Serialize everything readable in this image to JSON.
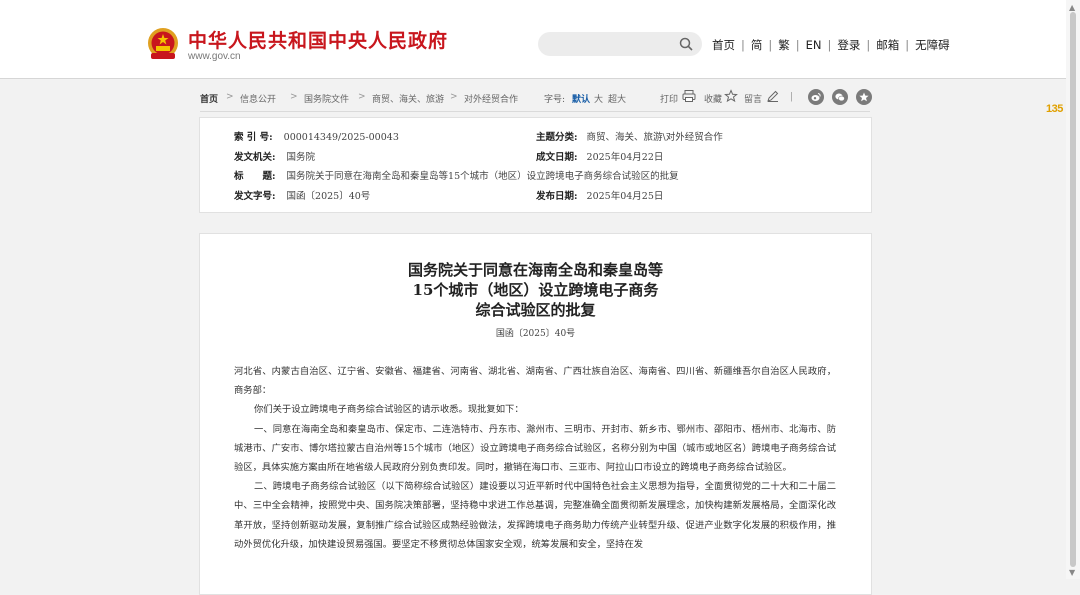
{
  "header": {
    "site_title": "中华人民共和国中央人民政府",
    "site_url": "www.gov.cn",
    "search_placeholder": "",
    "nav": [
      "首页",
      "简",
      "繁",
      "EN",
      "登录",
      "邮箱",
      "无障碍"
    ]
  },
  "breadcrumb": {
    "items": [
      "首页",
      "信息公开",
      "国务院文件",
      "商贸、海关、旅游",
      "对外经贸合作"
    ],
    "font_label": "字号:",
    "font_sizes": [
      "默认",
      "大",
      "超大"
    ],
    "print": "打印",
    "favorite": "收藏",
    "comment": "留言"
  },
  "meta": {
    "index_label": "索 引 号:",
    "index_value": "000014349/2025-00043",
    "category_label": "主题分类:",
    "category_value": "商贸、海关、旅游\\对外经贸合作",
    "issuer_label": "发文机关:",
    "issuer_value": "国务院",
    "written_label": "成文日期:",
    "written_value": "2025年04月22日",
    "title_label": "标　　题:",
    "title_value": "国务院关于同意在海南全岛和秦皇岛等15个城市（地区）设立跨境电子商务综合试验区的批复",
    "docno_label": "发文字号:",
    "docno_value": "国函〔2025〕40号",
    "published_label": "发布日期:",
    "published_value": "2025年04月25日"
  },
  "article": {
    "title_line1": "国务院关于同意在海南全岛和秦皇岛等",
    "title_line2": "15个城市（地区）设立跨境电子商务",
    "title_line3": "综合试验区的批复",
    "doc_number": "国函〔2025〕40号",
    "addressee": "河北省、内蒙古自治区、辽宁省、安徽省、福建省、河南省、湖北省、湖南省、广西壮族自治区、海南省、四川省、新疆维吾尔自治区人民政府，商务部：",
    "p1": "你们关于设立跨境电子商务综合试验区的请示收悉。现批复如下：",
    "p2": "一、同意在海南全岛和秦皇岛市、保定市、二连浩特市、丹东市、滁州市、三明市、开封市、新乡市、鄂州市、邵阳市、梧州市、北海市、防城港市、广安市、博尔塔拉蒙古自治州等15个城市（地区）设立跨境电子商务综合试验区，名称分别为中国（城市或地区名）跨境电子商务综合试验区，具体实施方案由所在地省级人民政府分别负责印发。同时，撤销在海口市、三亚市、阿拉山口市设立的跨境电子商务综合试验区。",
    "p3": "二、跨境电子商务综合试验区（以下简称综合试验区）建设要以习近平新时代中国特色社会主义思想为指导，全面贯彻党的二十大和二十届二中、三中全会精神，按照党中央、国务院决策部署，坚持稳中求进工作总基调，完整准确全面贯彻新发展理念，加快构建新发展格局，全面深化改革开放，坚持创新驱动发展，复制推广综合试验区成熟经验做法，发挥跨境电子商务助力传统产业转型升级、促进产业数字化发展的积极作用，推动外贸优化升级，加快建设贸易强国。要坚定不移贯彻总体国家安全观，统筹发展和安全，坚持在发"
  },
  "side_badge": "135",
  "colors": {
    "brand_red": "#c8161d",
    "page_bg": "#f2f2f2"
  }
}
